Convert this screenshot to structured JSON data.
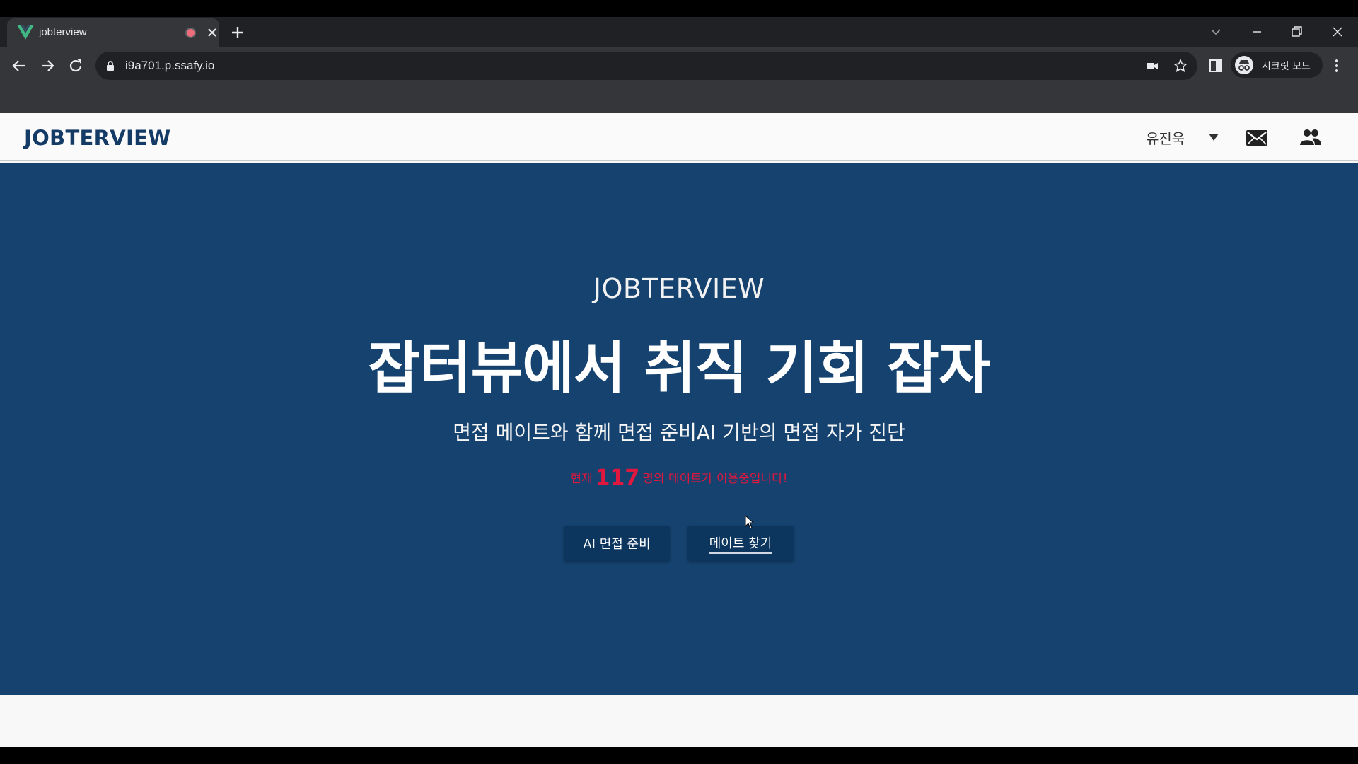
{
  "browser": {
    "tab_title": "jobterview",
    "url": "i9a701.p.ssafy.io",
    "incognito_label": "시크릿 모드",
    "icons": [
      "vue-logo-icon",
      "recording-icon",
      "close-icon",
      "plus-icon",
      "tab-search-icon",
      "minimize-icon",
      "restore-icon",
      "window-close-icon",
      "back-icon",
      "forward-icon",
      "reload-icon",
      "lock-icon",
      "camera-icon",
      "star-icon",
      "side-panel-icon",
      "incognito-icon",
      "more-icon"
    ]
  },
  "navbar": {
    "brand": "JOBTERVIEW",
    "user_name": "유진욱",
    "icons": [
      "caret-down-icon",
      "mail-icon",
      "people-icon"
    ]
  },
  "hero": {
    "brand": "JOBTERVIEW",
    "title": "잡터뷰에서 취직 기회 잡자",
    "subtitle": "면접 메이트와 함께 면접 준비AI 기반의 면접 자가 진단",
    "count_prefix": "현재",
    "count_value": "117",
    "count_suffix": "명의 메이트가 이용중입니다!",
    "buttons": {
      "ai": "AI 면접 준비",
      "mate": "메이트 찾기"
    }
  },
  "colors": {
    "hero_bg": "#15426e",
    "brand": "#143a66",
    "count": "#e0173f",
    "button_bg": "#0d365f"
  }
}
